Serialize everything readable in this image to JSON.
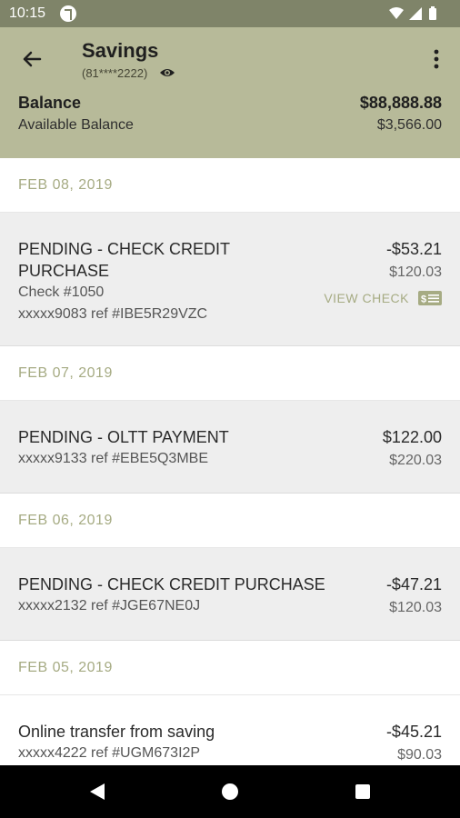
{
  "status_bar": {
    "time": "10:15"
  },
  "header": {
    "title": "Savings",
    "account_number": "(81****2222)",
    "balance_label": "Balance",
    "balance_value": "$88,888.88",
    "available_label": "Available Balance",
    "available_value": "$3,566.00"
  },
  "groups": [
    {
      "date": "FEB 08, 2019"
    },
    {
      "date": "FEB 07, 2019"
    },
    {
      "date": "FEB 06, 2019"
    },
    {
      "date": "FEB 05, 2019"
    }
  ],
  "transactions": [
    {
      "title": "PENDING - CHECK CREDIT PURCHASE",
      "check": "Check #1050",
      "ref": "xxxxx9083 ref #IBE5R29VZC",
      "amount": "-$53.21",
      "balance": "$120.03",
      "action": "VIEW CHECK"
    },
    {
      "title": "PENDING - OLTT PAYMENT",
      "ref": "xxxxx9133 ref #EBE5Q3MBE",
      "amount": "$122.00",
      "balance": "$220.03"
    },
    {
      "title": "PENDING - CHECK CREDIT PURCHASE",
      "ref": "xxxxx2132 ref #JGE67NE0J",
      "amount": "-$47.21",
      "balance": "$120.03"
    },
    {
      "title": "Online transfer from saving",
      "ref": "xxxxx4222 ref #UGM673I2P",
      "amount": "-$45.21",
      "balance": "$90.03"
    }
  ],
  "colors": {
    "header_bg": "#b7ba99",
    "status_bg": "#7f8469",
    "accent": "#a6ab83"
  },
  "icons": [
    "back-arrow-icon",
    "eye-icon",
    "more-vert-icon",
    "check-icon",
    "wifi-icon",
    "signal-icon",
    "battery-icon"
  ]
}
